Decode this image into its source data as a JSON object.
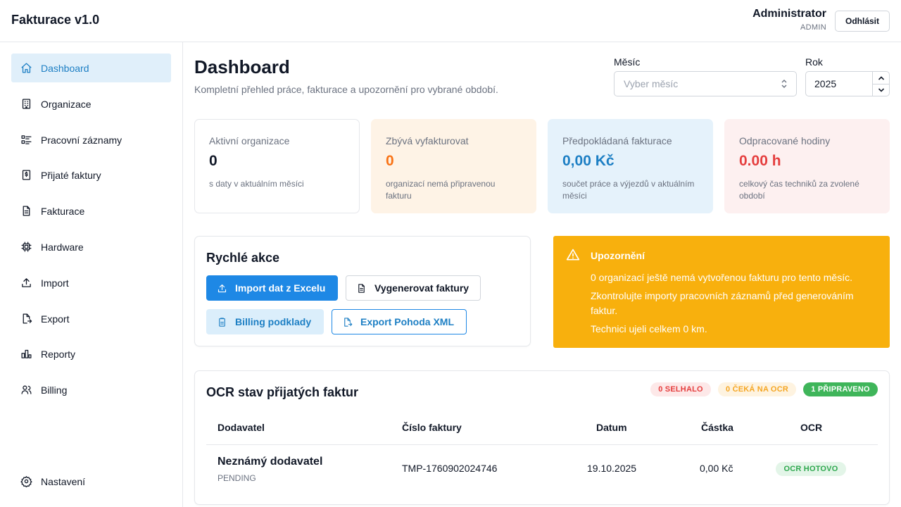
{
  "header": {
    "app_title": "Fakturace v1.0",
    "user_name": "Administrator",
    "user_role": "ADMIN",
    "logout_label": "Odhlásit"
  },
  "sidebar": {
    "items": [
      {
        "label": "Dashboard",
        "icon": "home-icon",
        "active": true
      },
      {
        "label": "Organizace",
        "icon": "building-icon"
      },
      {
        "label": "Pracovní záznamy",
        "icon": "list-icon"
      },
      {
        "label": "Přijaté faktury",
        "icon": "receipt-icon"
      },
      {
        "label": "Fakturace",
        "icon": "file-text-icon"
      },
      {
        "label": "Hardware",
        "icon": "chip-icon"
      },
      {
        "label": "Import",
        "icon": "upload-icon"
      },
      {
        "label": "Export",
        "icon": "file-export-icon"
      },
      {
        "label": "Reporty",
        "icon": "bar-chart-icon"
      },
      {
        "label": "Billing",
        "icon": "users-icon"
      }
    ],
    "settings_label": "Nastavení"
  },
  "main": {
    "title": "Dashboard",
    "subtitle": "Kompletní přehled práce, fakturace a upozornění pro vybrané období.",
    "month_label": "Měsíc",
    "month_placeholder": "Vyber měsíc",
    "year_label": "Rok",
    "year_value": "2025"
  },
  "stats": [
    {
      "label": "Aktivní organizace",
      "value": "0",
      "note": "s daty v aktuálním měsíci",
      "color": "#111827",
      "bg": "#ffffff"
    },
    {
      "label": "Zbývá vyfakturovat",
      "value": "0",
      "note": "organizací nemá připravenou fakturu",
      "color": "#f97316",
      "bg": "#fef3e6"
    },
    {
      "label": "Předpokládaná fakturace",
      "value": "0,00 Kč",
      "note": "součet práce a výjezdů v aktuálním měsíci",
      "color": "#1d7fc4",
      "bg": "#e5f2fb"
    },
    {
      "label": "Odpracované hodiny",
      "value": "0.00 h",
      "note": "celkový čas techniků za zvolené období",
      "color": "#e53e3e",
      "bg": "#fdf0f0"
    }
  ],
  "quick_actions": {
    "title": "Rychlé akce",
    "import_label": "Import dat z Excelu",
    "generate_label": "Vygenerovat faktury",
    "billing_label": "Billing podklady",
    "pohoda_label": "Export Pohoda XML"
  },
  "warning": {
    "title": "Upozornění",
    "lines": [
      "0 organizací ještě nemá vytvořenou fakturu pro tento měsíc.",
      "Zkontrolujte importy pracovních záznamů před generováním faktur.",
      "Technici ujeli celkem 0 km."
    ],
    "color": "#f8b00d"
  },
  "ocr": {
    "title": "OCR stav přijatých faktur",
    "badges": {
      "failed": "0 SELHALO",
      "waiting": "0 ČEKÁ NA OCR",
      "ready": "1 PŘIPRAVENO"
    },
    "columns": [
      "Dodavatel",
      "Číslo faktury",
      "Datum",
      "Částka",
      "OCR"
    ],
    "rows": [
      {
        "supplier": "Neznámý dodavatel",
        "supplier_status": "PENDING",
        "invoice_number": "TMP-1760902024746",
        "date": "19.10.2025",
        "amount": "0,00 Kč",
        "ocr_status": "OCR HOTOVO"
      }
    ]
  }
}
